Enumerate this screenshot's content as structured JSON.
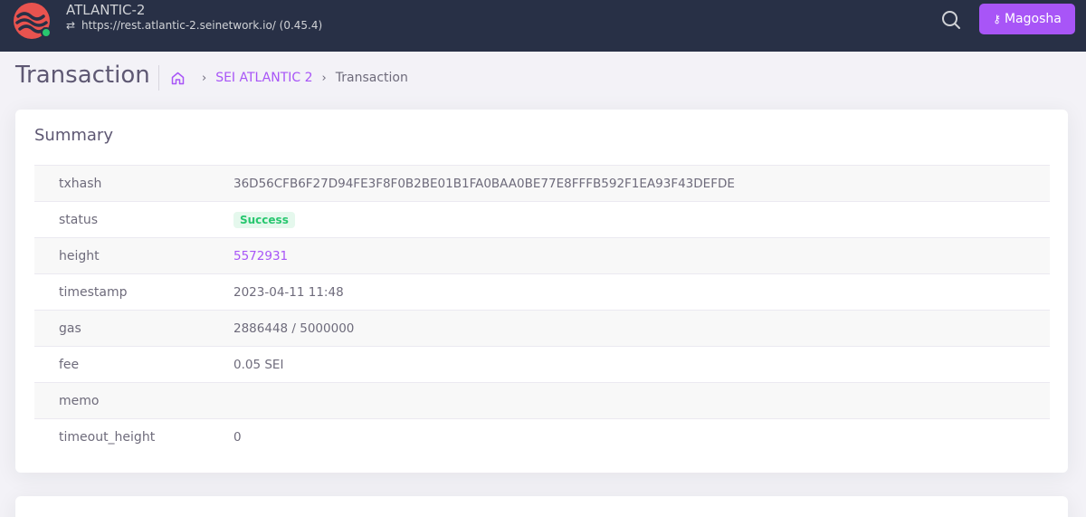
{
  "header": {
    "chain_name": "ATLANTIC-2",
    "endpoint": "https://rest.atlantic-2.seinetwork.io/ (0.45.4)",
    "wallet_label": "Magosha",
    "icons": {
      "logo": "sei-logo",
      "sync": "sync-icon",
      "search": "search-icon",
      "wallet": "key-icon"
    },
    "colors": {
      "bar": "#283046",
      "accent": "#a855f7",
      "online": "#28c76f"
    }
  },
  "page": {
    "title": "Transaction",
    "breadcrumb": {
      "items": [
        {
          "label": "SEI ATLANTIC 2"
        },
        {
          "label": "Transaction"
        }
      ]
    }
  },
  "summary": {
    "title": "Summary",
    "rows": [
      {
        "label": "txhash",
        "value": "36D56CFB6F27D94FE3F8F0B2BE01B1FA0BAA0BE77E8FFFB592F1EA93F43DEFDE"
      },
      {
        "label": "status",
        "value": "Success"
      },
      {
        "label": "height",
        "value": "5572931"
      },
      {
        "label": "timestamp",
        "value": "2023-04-11 11:48"
      },
      {
        "label": "gas",
        "value": "2886448 / 5000000"
      },
      {
        "label": "fee",
        "value": "0.05 SEI"
      },
      {
        "label": "memo",
        "value": ""
      },
      {
        "label": "timeout_height",
        "value": "0"
      }
    ]
  }
}
